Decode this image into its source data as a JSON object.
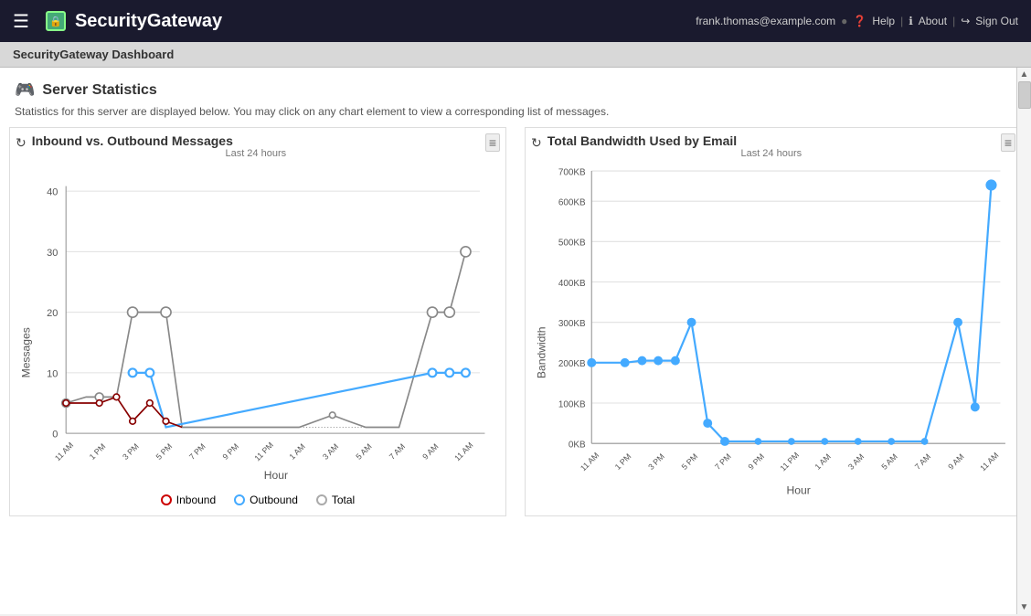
{
  "header": {
    "hamburger_label": "☰",
    "logo_security": "Security",
    "logo_gateway": "Gateway",
    "user_email": "frank.thomas@example.com",
    "help_label": "Help",
    "about_label": "About",
    "signout_label": "Sign Out"
  },
  "breadcrumb": {
    "title": "SecurityGateway Dashboard"
  },
  "server_statistics": {
    "section_title": "Server Statistics",
    "section_desc": "Statistics for this server are displayed below. You may click on any chart element to view a corresponding list of messages."
  },
  "chart1": {
    "title": "Inbound vs. Outbound Messages",
    "subtitle": "Last 24 hours",
    "x_label": "Hour",
    "y_label": "Messages",
    "x_ticks": [
      "11 AM",
      "1 PM",
      "3 PM",
      "5 PM",
      "7 PM",
      "9 PM",
      "11 PM",
      "1 AM",
      "3 AM",
      "5 AM",
      "7 AM",
      "9 AM",
      "11 AM"
    ],
    "y_ticks": [
      "0",
      "10",
      "20",
      "30",
      "40"
    ]
  },
  "chart2": {
    "title": "Total Bandwidth Used by Email",
    "subtitle": "Last 24 hours",
    "x_label": "Hour",
    "y_label": "Bandwidth",
    "x_ticks": [
      "11 AM",
      "1 PM",
      "3 PM",
      "5 PM",
      "7 PM",
      "9 PM",
      "11 PM",
      "1 AM",
      "3 AM",
      "5 AM",
      "7 AM",
      "9 AM",
      "11 AM"
    ],
    "y_ticks": [
      "0KB",
      "100KB",
      "200KB",
      "300KB",
      "400KB",
      "500KB",
      "600KB",
      "700KB"
    ]
  },
  "legend": {
    "inbound_label": "Inbound",
    "outbound_label": "Outbound",
    "total_label": "Total",
    "inbound_color": "#c00",
    "outbound_color": "#4af",
    "total_color": "#aaa"
  }
}
